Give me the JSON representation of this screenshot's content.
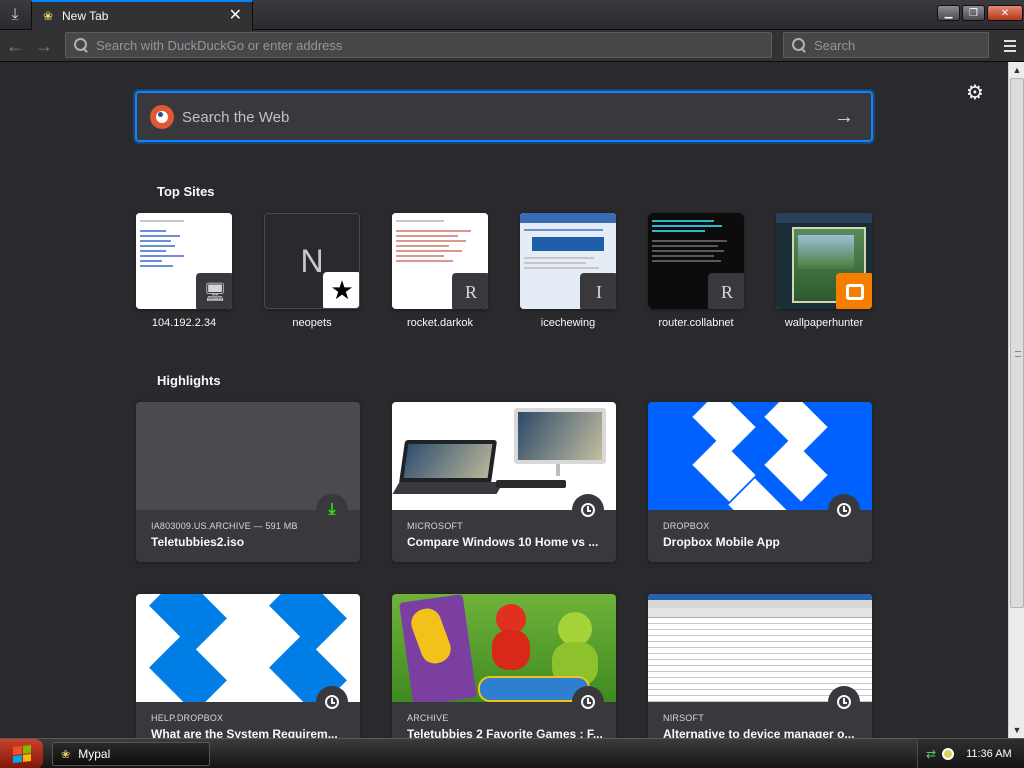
{
  "browser": {
    "tab_title": "New Tab",
    "url_placeholder": "Search with DuckDuckGo or enter address",
    "search_placeholder": "Search"
  },
  "newtab": {
    "search_placeholder": "Search the Web",
    "top_sites_heading": "Top Sites",
    "highlights_heading": "Highlights",
    "top_sites": [
      {
        "label": "104.192.2.34",
        "badge": "computer-icon"
      },
      {
        "label": "neopets",
        "tile_letter": "N",
        "badge": "star-icon"
      },
      {
        "label": "rocket.darkok",
        "badge_letter": "R"
      },
      {
        "label": "icechewing",
        "badge_letter": "I"
      },
      {
        "label": "router.collabnet",
        "badge_letter": "R"
      },
      {
        "label": "wallpaperhunter",
        "badge": "blogger-icon"
      }
    ],
    "highlights": [
      {
        "meta": "IA803009.US.ARCHIVE — 591 MB",
        "title": "Teletubbies2.iso",
        "status_icon": "download-icon"
      },
      {
        "meta": "MICROSOFT",
        "title": "Compare Windows 10 Home vs ...",
        "status_icon": "clock-icon"
      },
      {
        "meta": "DROPBOX",
        "title": "Dropbox Mobile App",
        "status_icon": "clock-icon"
      },
      {
        "meta": "HELP.DROPBOX",
        "title": "What are the System Requirem...",
        "status_icon": "clock-icon"
      },
      {
        "meta": "ARCHIVE",
        "title": "Teletubbies 2 Favorite Games : F...",
        "status_icon": "clock-icon"
      },
      {
        "meta": "NIRSOFT",
        "title": "Alternative to device manager o...",
        "status_icon": "clock-icon"
      }
    ]
  },
  "taskbar": {
    "app_label": "Mypal",
    "clock": "11:36 AM"
  },
  "colors": {
    "accent": "#0a84ff",
    "background": "#2a2a2e",
    "card": "#38383d",
    "download_green": "#30e60b",
    "dropbox_blue": "#0061fe"
  }
}
